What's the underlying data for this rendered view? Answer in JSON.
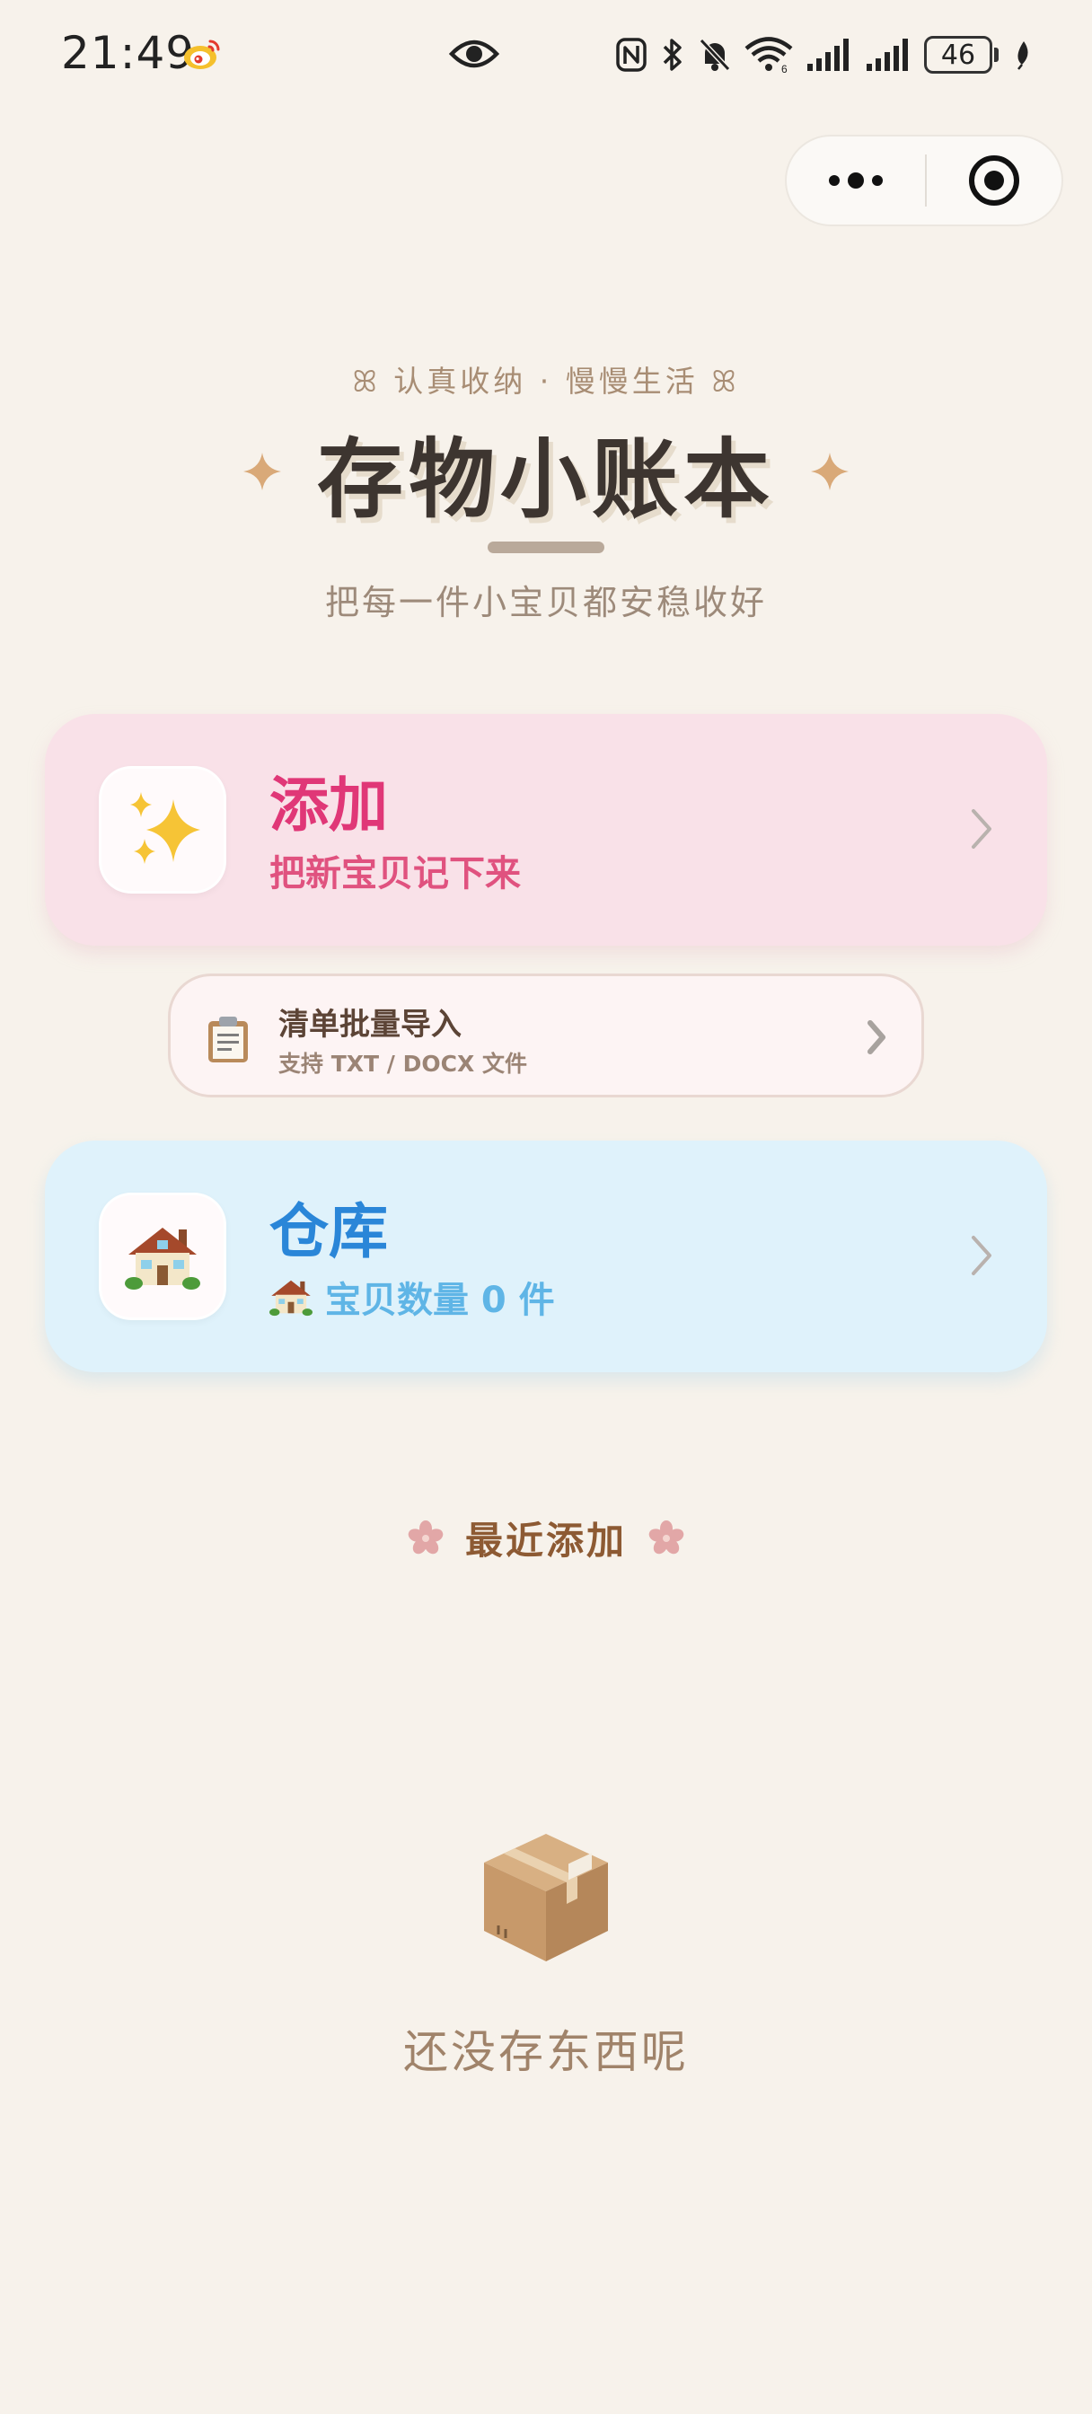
{
  "status_bar": {
    "time": "21:49",
    "battery": "46",
    "icons": [
      "weibo-icon",
      "eye-icon",
      "nfc-icon",
      "bluetooth-icon",
      "mute-icon",
      "wifi-icon",
      "signal-icon",
      "signal-icon",
      "battery-icon",
      "leaf-icon"
    ]
  },
  "capsule": {
    "more_icon": "more-dots-icon",
    "close_icon": "target-circle-icon"
  },
  "header": {
    "tagline": "ꕤ 认真收纳 · 慢慢生活 ꕤ",
    "title": "存物小账本",
    "subtitle": "把每一件小宝贝都安稳收好"
  },
  "cards": {
    "add": {
      "icon": "sparkles-icon",
      "title": "添加",
      "subtitle": "把新宝贝记下来"
    },
    "import": {
      "icon": "clipboard-icon",
      "title": "清单批量导入",
      "subtitle": "支持 TXT / DOCX 文件"
    },
    "warehouse": {
      "icon": "house-icon",
      "title": "仓库",
      "subtitle": "宝贝数量 0 件"
    }
  },
  "recent": {
    "title": "最近添加",
    "empty_icon": "package-box-icon",
    "empty_text": "还没存东西呢"
  },
  "colors": {
    "background": "#f7f2eb",
    "add_card": "#f9e1e8",
    "add_accent": "#e03777",
    "warehouse_card": "#dff2fb",
    "warehouse_accent": "#2a86d8",
    "title_text": "#3d3530",
    "sparkle": "#d9a978"
  }
}
